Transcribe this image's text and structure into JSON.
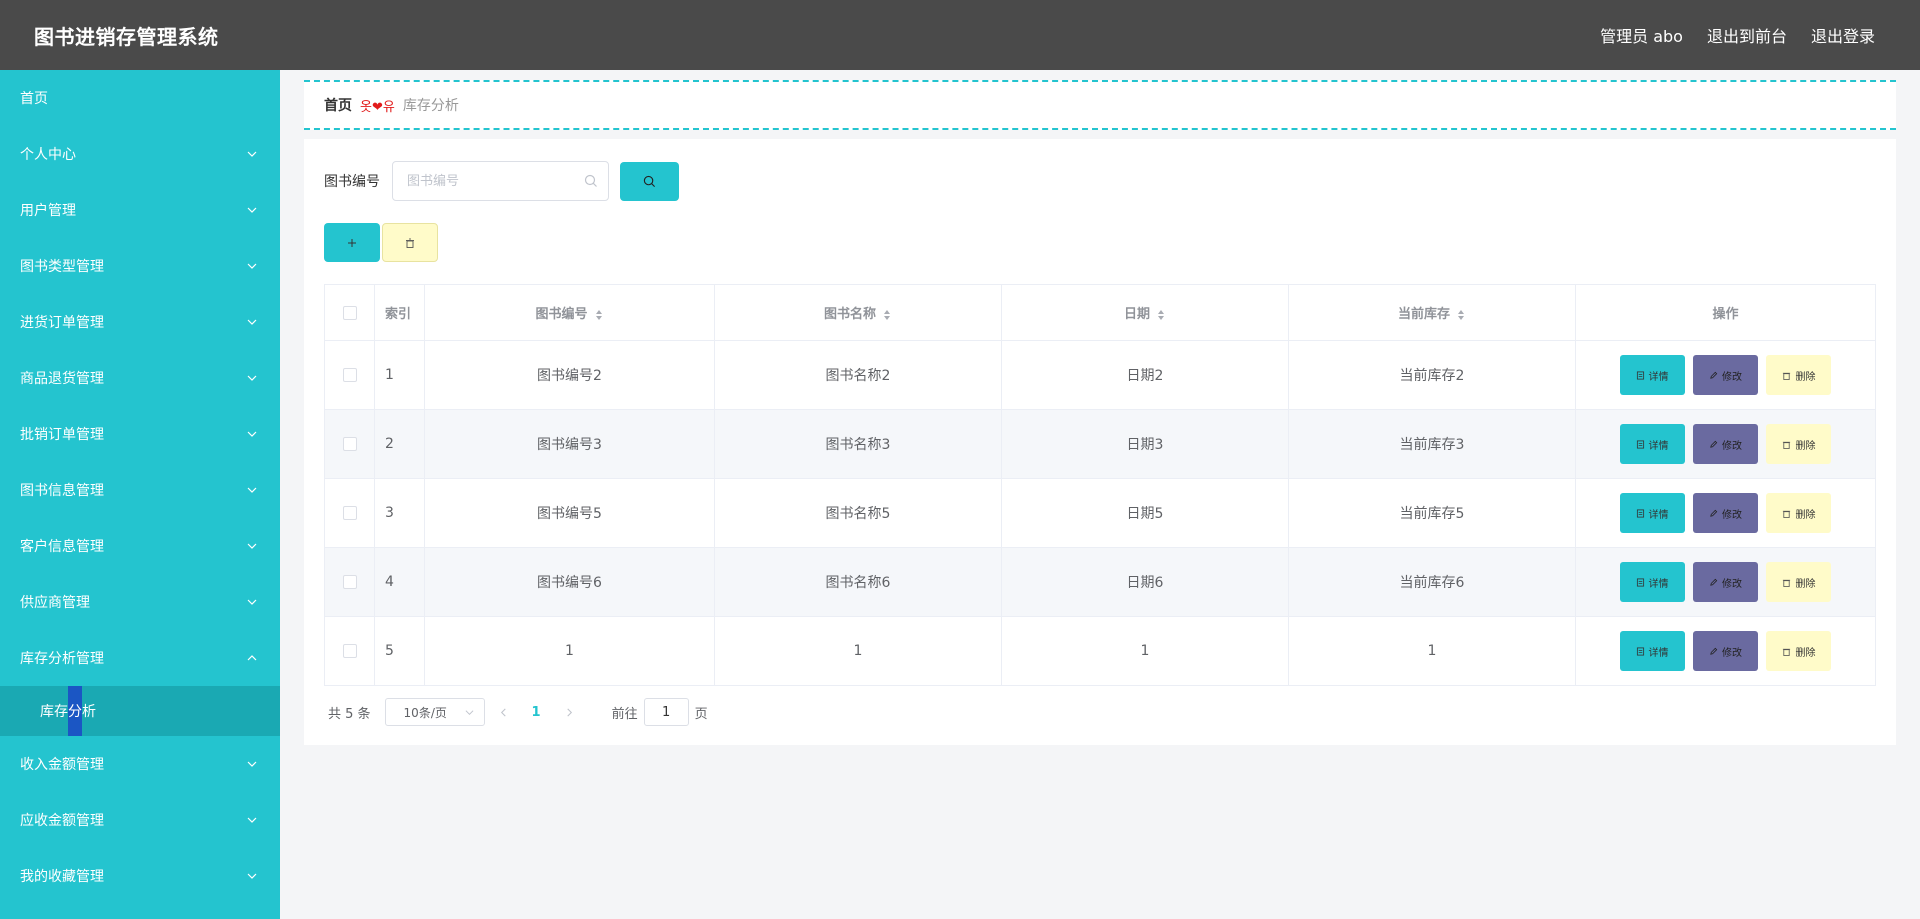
{
  "header": {
    "title": "图书进销存管理系统",
    "user": "管理员 abo",
    "to_front": "退出到前台",
    "logout": "退出登录"
  },
  "sidebar": {
    "items": [
      {
        "label": "首页",
        "expandable": false
      },
      {
        "label": "个人中心",
        "expandable": true
      },
      {
        "label": "用户管理",
        "expandable": true
      },
      {
        "label": "图书类型管理",
        "expandable": true
      },
      {
        "label": "进货订单管理",
        "expandable": true
      },
      {
        "label": "商品退货管理",
        "expandable": true
      },
      {
        "label": "批销订单管理",
        "expandable": true
      },
      {
        "label": "图书信息管理",
        "expandable": true
      },
      {
        "label": "客户信息管理",
        "expandable": true
      },
      {
        "label": "供应商管理",
        "expandable": true
      },
      {
        "label": "库存分析管理",
        "expandable": true,
        "expanded": true
      },
      {
        "label": "收入金额管理",
        "expandable": true
      },
      {
        "label": "应收金额管理",
        "expandable": true
      },
      {
        "label": "我的收藏管理",
        "expandable": true
      }
    ],
    "active_sub": "库存分析"
  },
  "breadcrumb": {
    "home": "首页",
    "separator": "옷❤유",
    "current": "库存分析"
  },
  "search": {
    "label": "图书编号",
    "placeholder": "图书编号",
    "value": ""
  },
  "table": {
    "columns": {
      "index": "索引",
      "book_no": "图书编号",
      "book_name": "图书名称",
      "date": "日期",
      "stock": "当前库存",
      "ops": "操作"
    },
    "rows": [
      {
        "index": "1",
        "book_no": "图书编号2",
        "book_name": "图书名称2",
        "date": "日期2",
        "stock": "当前库存2"
      },
      {
        "index": "2",
        "book_no": "图书编号3",
        "book_name": "图书名称3",
        "date": "日期3",
        "stock": "当前库存3"
      },
      {
        "index": "3",
        "book_no": "图书编号5",
        "book_name": "图书名称5",
        "date": "日期5",
        "stock": "当前库存5"
      },
      {
        "index": "4",
        "book_no": "图书编号6",
        "book_name": "图书名称6",
        "date": "日期6",
        "stock": "当前库存6"
      },
      {
        "index": "5",
        "book_no": "1",
        "book_name": "1",
        "date": "1",
        "stock": "1"
      }
    ],
    "ops": {
      "detail": "详情",
      "edit": "修改",
      "delete": "删除"
    }
  },
  "pagination": {
    "total": "共 5 条",
    "page_size": "10条/页",
    "current_page": "1",
    "goto_label": "前往",
    "goto_value": "1",
    "page_suffix": "页"
  },
  "colors": {
    "accent": "#24c4cf",
    "header_bg": "#4a4a4a",
    "edit_button": "#6a6aa0",
    "delete_button": "#fffbc9"
  }
}
